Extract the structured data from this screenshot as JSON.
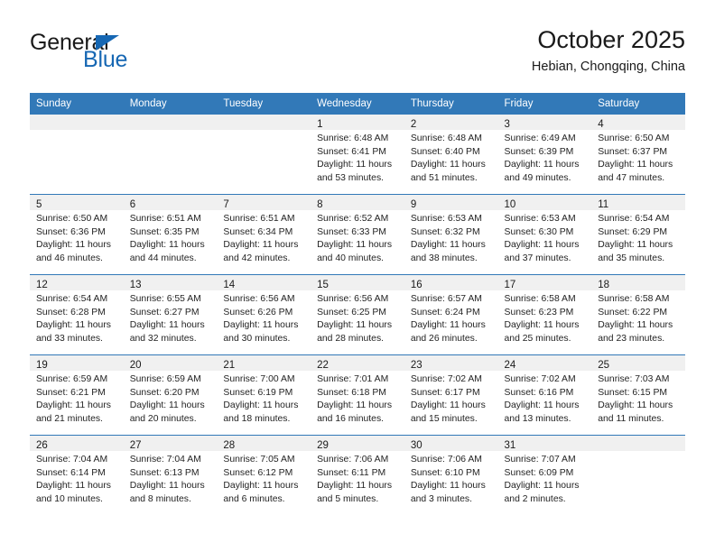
{
  "brand": {
    "word_one": "General",
    "word_two": "Blue",
    "triangle_icon": "triangle-right-icon",
    "accent_color": "#1667b3"
  },
  "header": {
    "title": "October 2025",
    "subtitle": "Hebian, Chongqing, China"
  },
  "theme": {
    "header_blue": "#3279b8",
    "row_divider_blue": "#3279b8",
    "daynum_band_gray": "#f0f0f0",
    "text_color": "#232323"
  },
  "weekday_headers": [
    "Sunday",
    "Monday",
    "Tuesday",
    "Wednesday",
    "Thursday",
    "Friday",
    "Saturday"
  ],
  "labels": {
    "sunrise_prefix": "Sunrise:",
    "sunset_prefix": "Sunset:",
    "daylight_prefix": "Daylight:"
  },
  "weeks": [
    [
      {
        "blank": true
      },
      {
        "blank": true
      },
      {
        "blank": true
      },
      {
        "day": "1",
        "sunrise": "Sunrise: 6:48 AM",
        "sunset": "Sunset: 6:41 PM",
        "daylight_line1": "Daylight: 11 hours",
        "daylight_line2": "and 53 minutes."
      },
      {
        "day": "2",
        "sunrise": "Sunrise: 6:48 AM",
        "sunset": "Sunset: 6:40 PM",
        "daylight_line1": "Daylight: 11 hours",
        "daylight_line2": "and 51 minutes."
      },
      {
        "day": "3",
        "sunrise": "Sunrise: 6:49 AM",
        "sunset": "Sunset: 6:39 PM",
        "daylight_line1": "Daylight: 11 hours",
        "daylight_line2": "and 49 minutes."
      },
      {
        "day": "4",
        "sunrise": "Sunrise: 6:50 AM",
        "sunset": "Sunset: 6:37 PM",
        "daylight_line1": "Daylight: 11 hours",
        "daylight_line2": "and 47 minutes."
      }
    ],
    [
      {
        "day": "5",
        "sunrise": "Sunrise: 6:50 AM",
        "sunset": "Sunset: 6:36 PM",
        "daylight_line1": "Daylight: 11 hours",
        "daylight_line2": "and 46 minutes."
      },
      {
        "day": "6",
        "sunrise": "Sunrise: 6:51 AM",
        "sunset": "Sunset: 6:35 PM",
        "daylight_line1": "Daylight: 11 hours",
        "daylight_line2": "and 44 minutes."
      },
      {
        "day": "7",
        "sunrise": "Sunrise: 6:51 AM",
        "sunset": "Sunset: 6:34 PM",
        "daylight_line1": "Daylight: 11 hours",
        "daylight_line2": "and 42 minutes."
      },
      {
        "day": "8",
        "sunrise": "Sunrise: 6:52 AM",
        "sunset": "Sunset: 6:33 PM",
        "daylight_line1": "Daylight: 11 hours",
        "daylight_line2": "and 40 minutes."
      },
      {
        "day": "9",
        "sunrise": "Sunrise: 6:53 AM",
        "sunset": "Sunset: 6:32 PM",
        "daylight_line1": "Daylight: 11 hours",
        "daylight_line2": "and 38 minutes."
      },
      {
        "day": "10",
        "sunrise": "Sunrise: 6:53 AM",
        "sunset": "Sunset: 6:30 PM",
        "daylight_line1": "Daylight: 11 hours",
        "daylight_line2": "and 37 minutes."
      },
      {
        "day": "11",
        "sunrise": "Sunrise: 6:54 AM",
        "sunset": "Sunset: 6:29 PM",
        "daylight_line1": "Daylight: 11 hours",
        "daylight_line2": "and 35 minutes."
      }
    ],
    [
      {
        "day": "12",
        "sunrise": "Sunrise: 6:54 AM",
        "sunset": "Sunset: 6:28 PM",
        "daylight_line1": "Daylight: 11 hours",
        "daylight_line2": "and 33 minutes."
      },
      {
        "day": "13",
        "sunrise": "Sunrise: 6:55 AM",
        "sunset": "Sunset: 6:27 PM",
        "daylight_line1": "Daylight: 11 hours",
        "daylight_line2": "and 32 minutes."
      },
      {
        "day": "14",
        "sunrise": "Sunrise: 6:56 AM",
        "sunset": "Sunset: 6:26 PM",
        "daylight_line1": "Daylight: 11 hours",
        "daylight_line2": "and 30 minutes."
      },
      {
        "day": "15",
        "sunrise": "Sunrise: 6:56 AM",
        "sunset": "Sunset: 6:25 PM",
        "daylight_line1": "Daylight: 11 hours",
        "daylight_line2": "and 28 minutes."
      },
      {
        "day": "16",
        "sunrise": "Sunrise: 6:57 AM",
        "sunset": "Sunset: 6:24 PM",
        "daylight_line1": "Daylight: 11 hours",
        "daylight_line2": "and 26 minutes."
      },
      {
        "day": "17",
        "sunrise": "Sunrise: 6:58 AM",
        "sunset": "Sunset: 6:23 PM",
        "daylight_line1": "Daylight: 11 hours",
        "daylight_line2": "and 25 minutes."
      },
      {
        "day": "18",
        "sunrise": "Sunrise: 6:58 AM",
        "sunset": "Sunset: 6:22 PM",
        "daylight_line1": "Daylight: 11 hours",
        "daylight_line2": "and 23 minutes."
      }
    ],
    [
      {
        "day": "19",
        "sunrise": "Sunrise: 6:59 AM",
        "sunset": "Sunset: 6:21 PM",
        "daylight_line1": "Daylight: 11 hours",
        "daylight_line2": "and 21 minutes."
      },
      {
        "day": "20",
        "sunrise": "Sunrise: 6:59 AM",
        "sunset": "Sunset: 6:20 PM",
        "daylight_line1": "Daylight: 11 hours",
        "daylight_line2": "and 20 minutes."
      },
      {
        "day": "21",
        "sunrise": "Sunrise: 7:00 AM",
        "sunset": "Sunset: 6:19 PM",
        "daylight_line1": "Daylight: 11 hours",
        "daylight_line2": "and 18 minutes."
      },
      {
        "day": "22",
        "sunrise": "Sunrise: 7:01 AM",
        "sunset": "Sunset: 6:18 PM",
        "daylight_line1": "Daylight: 11 hours",
        "daylight_line2": "and 16 minutes."
      },
      {
        "day": "23",
        "sunrise": "Sunrise: 7:02 AM",
        "sunset": "Sunset: 6:17 PM",
        "daylight_line1": "Daylight: 11 hours",
        "daylight_line2": "and 15 minutes."
      },
      {
        "day": "24",
        "sunrise": "Sunrise: 7:02 AM",
        "sunset": "Sunset: 6:16 PM",
        "daylight_line1": "Daylight: 11 hours",
        "daylight_line2": "and 13 minutes."
      },
      {
        "day": "25",
        "sunrise": "Sunrise: 7:03 AM",
        "sunset": "Sunset: 6:15 PM",
        "daylight_line1": "Daylight: 11 hours",
        "daylight_line2": "and 11 minutes."
      }
    ],
    [
      {
        "day": "26",
        "sunrise": "Sunrise: 7:04 AM",
        "sunset": "Sunset: 6:14 PM",
        "daylight_line1": "Daylight: 11 hours",
        "daylight_line2": "and 10 minutes."
      },
      {
        "day": "27",
        "sunrise": "Sunrise: 7:04 AM",
        "sunset": "Sunset: 6:13 PM",
        "daylight_line1": "Daylight: 11 hours",
        "daylight_line2": "and 8 minutes."
      },
      {
        "day": "28",
        "sunrise": "Sunrise: 7:05 AM",
        "sunset": "Sunset: 6:12 PM",
        "daylight_line1": "Daylight: 11 hours",
        "daylight_line2": "and 6 minutes."
      },
      {
        "day": "29",
        "sunrise": "Sunrise: 7:06 AM",
        "sunset": "Sunset: 6:11 PM",
        "daylight_line1": "Daylight: 11 hours",
        "daylight_line2": "and 5 minutes."
      },
      {
        "day": "30",
        "sunrise": "Sunrise: 7:06 AM",
        "sunset": "Sunset: 6:10 PM",
        "daylight_line1": "Daylight: 11 hours",
        "daylight_line2": "and 3 minutes."
      },
      {
        "day": "31",
        "sunrise": "Sunrise: 7:07 AM",
        "sunset": "Sunset: 6:09 PM",
        "daylight_line1": "Daylight: 11 hours",
        "daylight_line2": "and 2 minutes."
      },
      {
        "blank": true
      }
    ]
  ]
}
